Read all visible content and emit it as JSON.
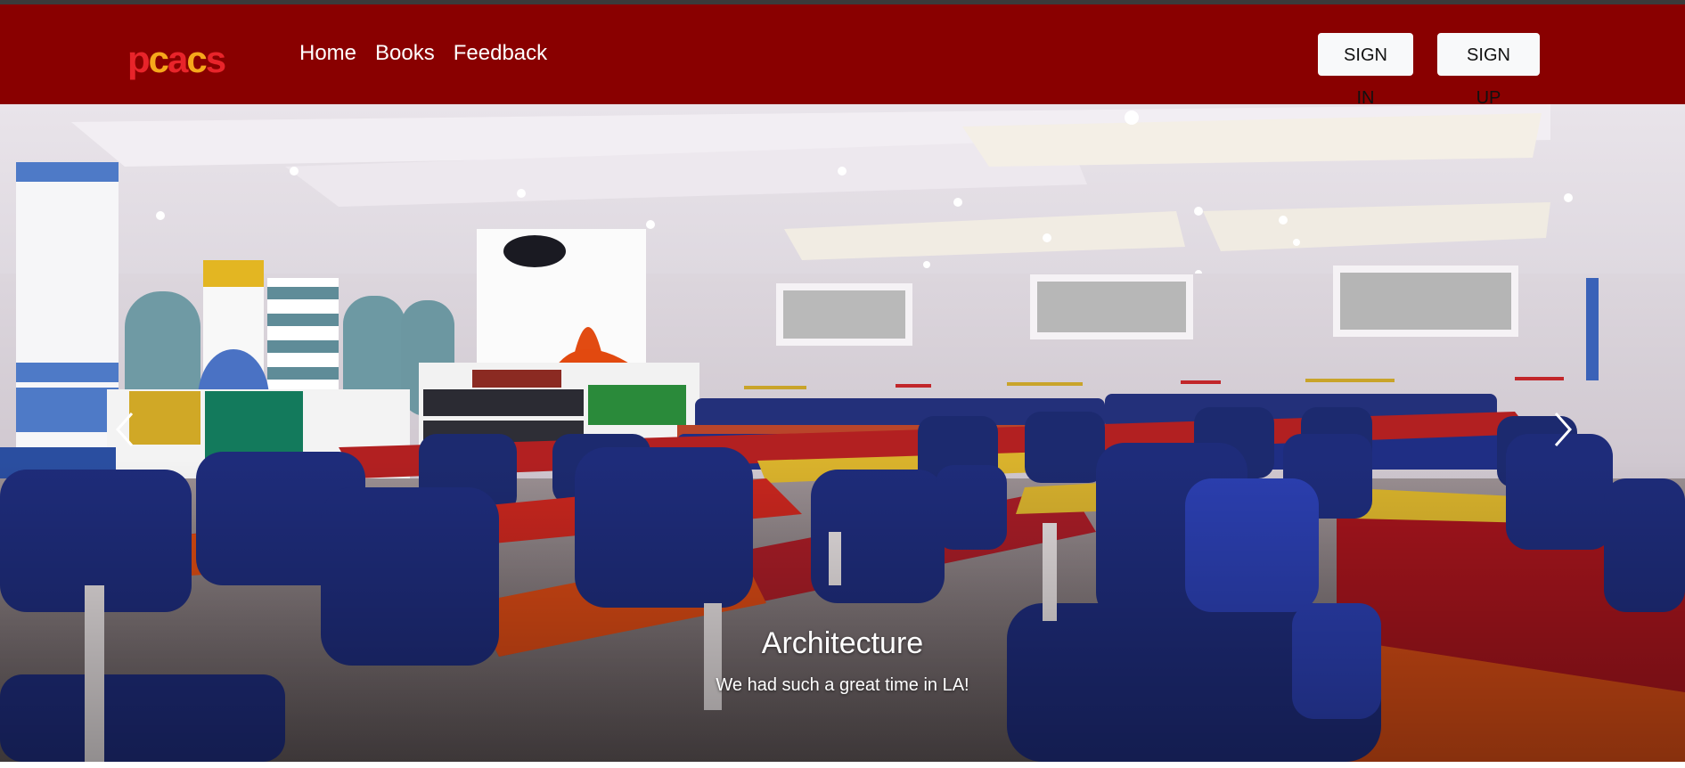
{
  "brand": {
    "letters": [
      "p",
      "c",
      "a",
      "c",
      "s"
    ],
    "colors": [
      "#e8242a",
      "#f6a81b",
      "#e8242a",
      "#f6a81b",
      "#e8242a"
    ]
  },
  "nav": {
    "items": [
      "Home",
      "Books",
      "Feedback"
    ]
  },
  "auth": {
    "signin_label": "SIGN IN",
    "signup_label": "SIGN UP"
  },
  "carousel": {
    "caption_title": "Architecture",
    "caption_text": "We had such a great time in LA!",
    "prev_icon": "chevron-left-icon",
    "next_icon": "chevron-right-icon"
  },
  "colors": {
    "navbar": "#890000",
    "button_bg": "#f8f9fa"
  }
}
